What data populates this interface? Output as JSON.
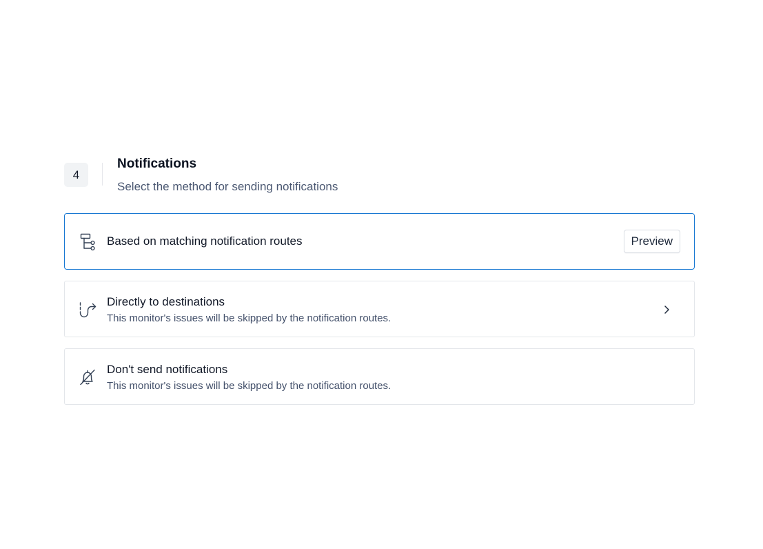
{
  "section": {
    "step_number": "4",
    "title": "Notifications",
    "subtitle": "Select the method for sending notifications"
  },
  "options": [
    {
      "title": "Based on matching notification routes",
      "icon": "routes-icon",
      "selected": true,
      "action_label": "Preview"
    },
    {
      "title": "Directly to destinations",
      "description": "This monitor's issues will be skipped by the notification routes.",
      "icon": "redirect-arrow-icon",
      "selected": false,
      "trailing_icon": "chevron-right-icon"
    },
    {
      "title": "Don't send notifications",
      "description": "This monitor's issues will be skipped by the notification routes.",
      "icon": "bell-off-icon",
      "selected": false
    }
  ],
  "colors": {
    "accent": "#1677d2",
    "border": "#e3e6ea",
    "text_primary": "#111827",
    "text_secondary": "#44516b",
    "badge_bg": "#f1f3f5"
  }
}
